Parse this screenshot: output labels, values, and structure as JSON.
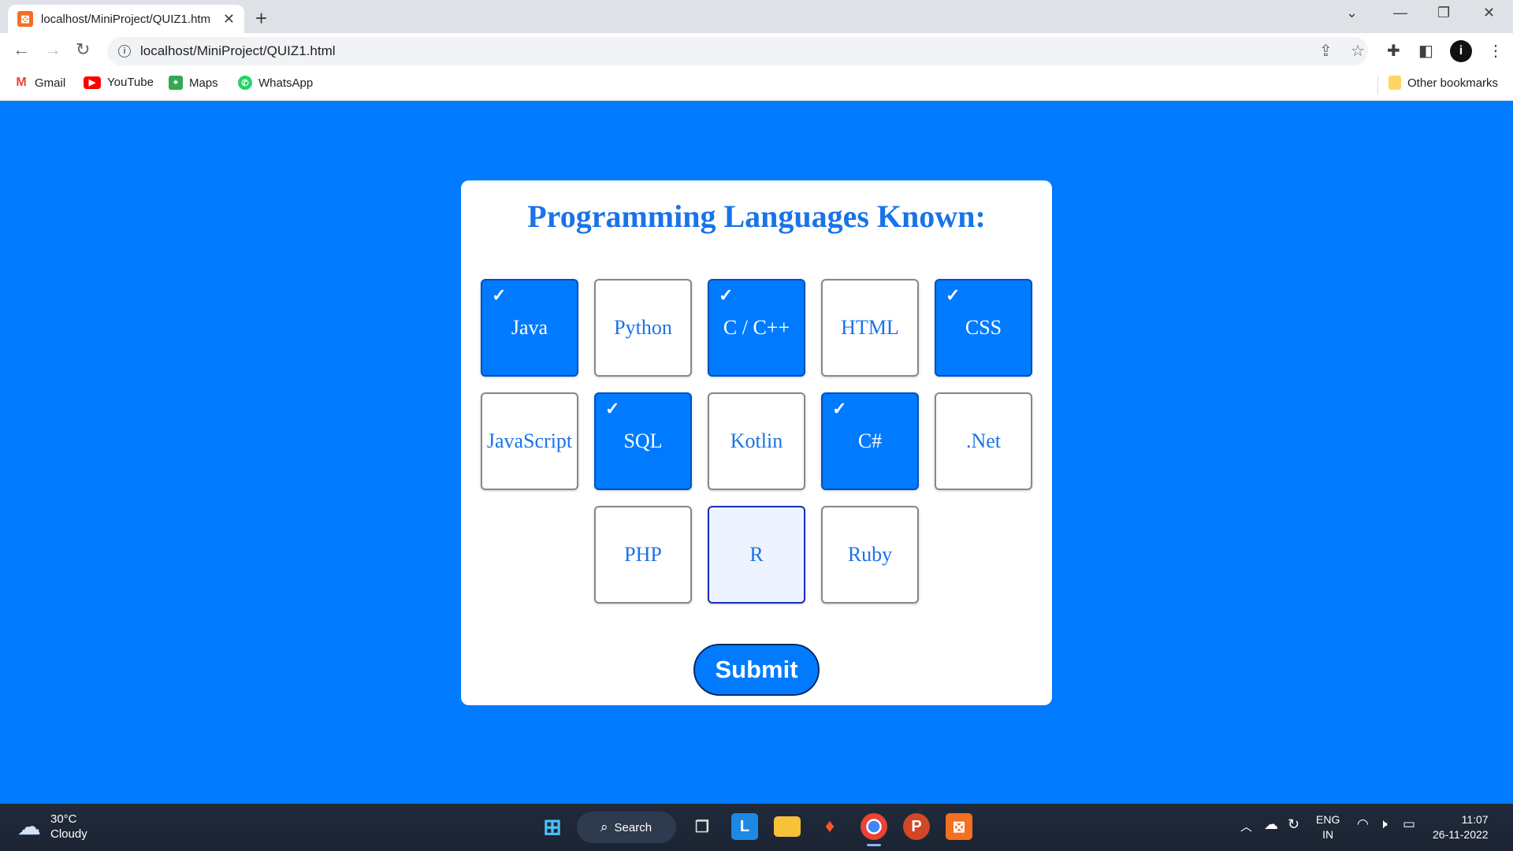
{
  "browser": {
    "tab_title": "localhost/MiniProject/QUIZ1.htm",
    "new_tab_label": "+",
    "url": "localhost/MiniProject/QUIZ1.html",
    "profile_initial": "i",
    "bookmarks": [
      "Gmail",
      "YouTube",
      "Maps",
      "WhatsApp"
    ],
    "other_bookmarks": "Other bookmarks"
  },
  "quiz": {
    "title": "Programming Languages Known:",
    "options": [
      {
        "label": "Java",
        "checked": true
      },
      {
        "label": "Python",
        "checked": false
      },
      {
        "label": "C / C++",
        "checked": true
      },
      {
        "label": "HTML",
        "checked": false
      },
      {
        "label": "CSS",
        "checked": true
      },
      {
        "label": "JavaScript",
        "checked": false
      },
      {
        "label": "SQL",
        "checked": true
      },
      {
        "label": "Kotlin",
        "checked": false
      },
      {
        "label": "C#",
        "checked": true
      },
      {
        "label": ".Net",
        "checked": false
      },
      {
        "label": "PHP",
        "checked": false
      },
      {
        "label": "R",
        "checked": false,
        "hovered": true
      },
      {
        "label": "Ruby",
        "checked": false
      }
    ],
    "check_glyph": "✓",
    "submit_label": "Submit"
  },
  "taskbar": {
    "weather_temp": "30°C",
    "weather_desc": "Cloudy",
    "search_label": "Search",
    "lang_top": "ENG",
    "lang_bottom": "IN",
    "time": "11:07",
    "date": "26-11-2022"
  },
  "colors": {
    "page_bg": "#007bff",
    "accent_text": "#1a73e8",
    "checked_bg": "#007bff"
  }
}
